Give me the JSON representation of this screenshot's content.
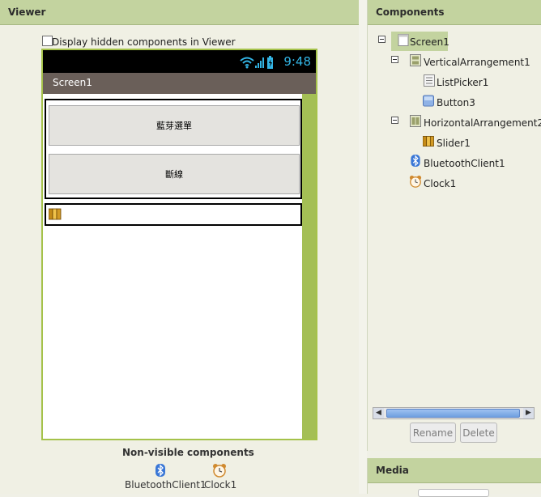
{
  "viewer": {
    "title": "Viewer",
    "hidden_components_label": "Display hidden components in Viewer",
    "phone": {
      "status_time": "9:48",
      "screen_title": "Screen1",
      "buttons": [
        "藍芽選單",
        "斷線"
      ]
    },
    "nonvisible": {
      "title": "Non-visible components",
      "items": [
        "BluetoothClient1",
        "Clock1"
      ]
    }
  },
  "components": {
    "title": "Components",
    "tree": [
      {
        "label": "Screen1",
        "icon": "screen-icon"
      },
      {
        "label": "VerticalArrangement1",
        "icon": "vertical-arrangement-icon"
      },
      {
        "label": "ListPicker1",
        "icon": "list-picker-icon"
      },
      {
        "label": "Button3",
        "icon": "button-icon"
      },
      {
        "label": "HorizontalArrangement2",
        "icon": "horizontal-arrangement-icon"
      },
      {
        "label": "Slider1",
        "icon": "slider-icon"
      },
      {
        "label": "BluetoothClient1",
        "icon": "bluetooth-icon"
      },
      {
        "label": "Clock1",
        "icon": "clock-icon"
      }
    ],
    "rename_label": "Rename",
    "delete_label": "Delete"
  },
  "media": {
    "title": "Media"
  },
  "colors": {
    "header_green": "#c3d39f",
    "phone_border": "#a5c24a",
    "status_blue": "#33b5e5",
    "titlebar": "#6a5f59"
  }
}
